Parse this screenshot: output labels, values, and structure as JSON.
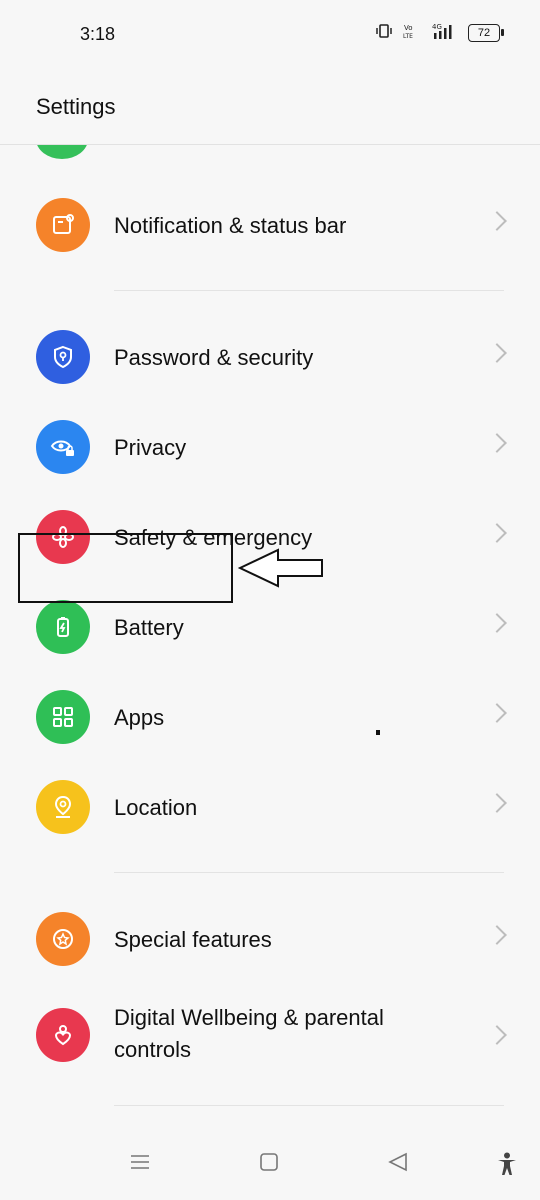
{
  "status_bar": {
    "time": "3:18",
    "battery": "72",
    "icons": [
      "vibrate-icon",
      "volte-icon",
      "signal-4g-icon",
      "battery-icon"
    ]
  },
  "header": {
    "title": "Settings"
  },
  "items": [
    {
      "label": "Notification & status bar",
      "icon": "notification-icon",
      "color": "#f5832a"
    },
    {
      "label": "Password & security",
      "icon": "shield-lock-icon",
      "color": "#2f5fe0"
    },
    {
      "label": "Privacy",
      "icon": "eye-lock-icon",
      "color": "#2b86f0"
    },
    {
      "label": "Safety & emergency",
      "icon": "asterisk-icon",
      "color": "#e8384f"
    },
    {
      "label": "Battery",
      "icon": "battery-icon",
      "color": "#2fbf56"
    },
    {
      "label": "Apps",
      "icon": "grid-icon",
      "color": "#2fbf56"
    },
    {
      "label": "Location",
      "icon": "location-pin-icon",
      "color": "#f6c21c"
    },
    {
      "label": "Special features",
      "icon": "star-icon",
      "color": "#f5832a"
    },
    {
      "label": "Digital Wellbeing & parental controls",
      "icon": "heart-person-icon",
      "color": "#e8384f"
    }
  ],
  "nav_bar": [
    "menu-icon",
    "home-icon",
    "back-icon",
    "accessibility-icon"
  ]
}
